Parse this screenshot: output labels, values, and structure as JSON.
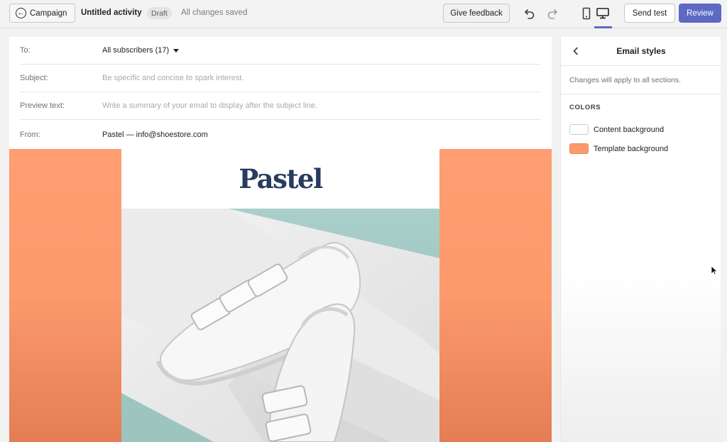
{
  "topbar": {
    "back_label": "Campaign",
    "activity_title": "Untitled activity",
    "status_badge": "Draft",
    "save_status": "All changes saved",
    "feedback_label": "Give feedback",
    "send_test_label": "Send test",
    "review_label": "Review",
    "accent_color": "#5c6ac4"
  },
  "fields": {
    "to": {
      "label": "To:",
      "value": "All subscribers (17)"
    },
    "subject": {
      "label": "Subject:",
      "placeholder": "Be specific and concise to spark interest."
    },
    "preview": {
      "label": "Preview text:",
      "placeholder": "Write a summary of your email to display after the subject line."
    },
    "from": {
      "label": "From:",
      "value": "Pastel — info@shoestore.com"
    }
  },
  "email": {
    "logo_text": "Pastel",
    "hero_icon": "white-sneakers-photo",
    "template_background_color": "#fc9a6c",
    "content_background_color": "#ffffff"
  },
  "styles_panel": {
    "title": "Email styles",
    "note": "Changes will apply to all sections.",
    "section_heading": "COLORS",
    "colors": [
      {
        "label": "Content background",
        "hex": "#ffffff"
      },
      {
        "label": "Template background",
        "hex": "#fc9a6c"
      }
    ]
  }
}
